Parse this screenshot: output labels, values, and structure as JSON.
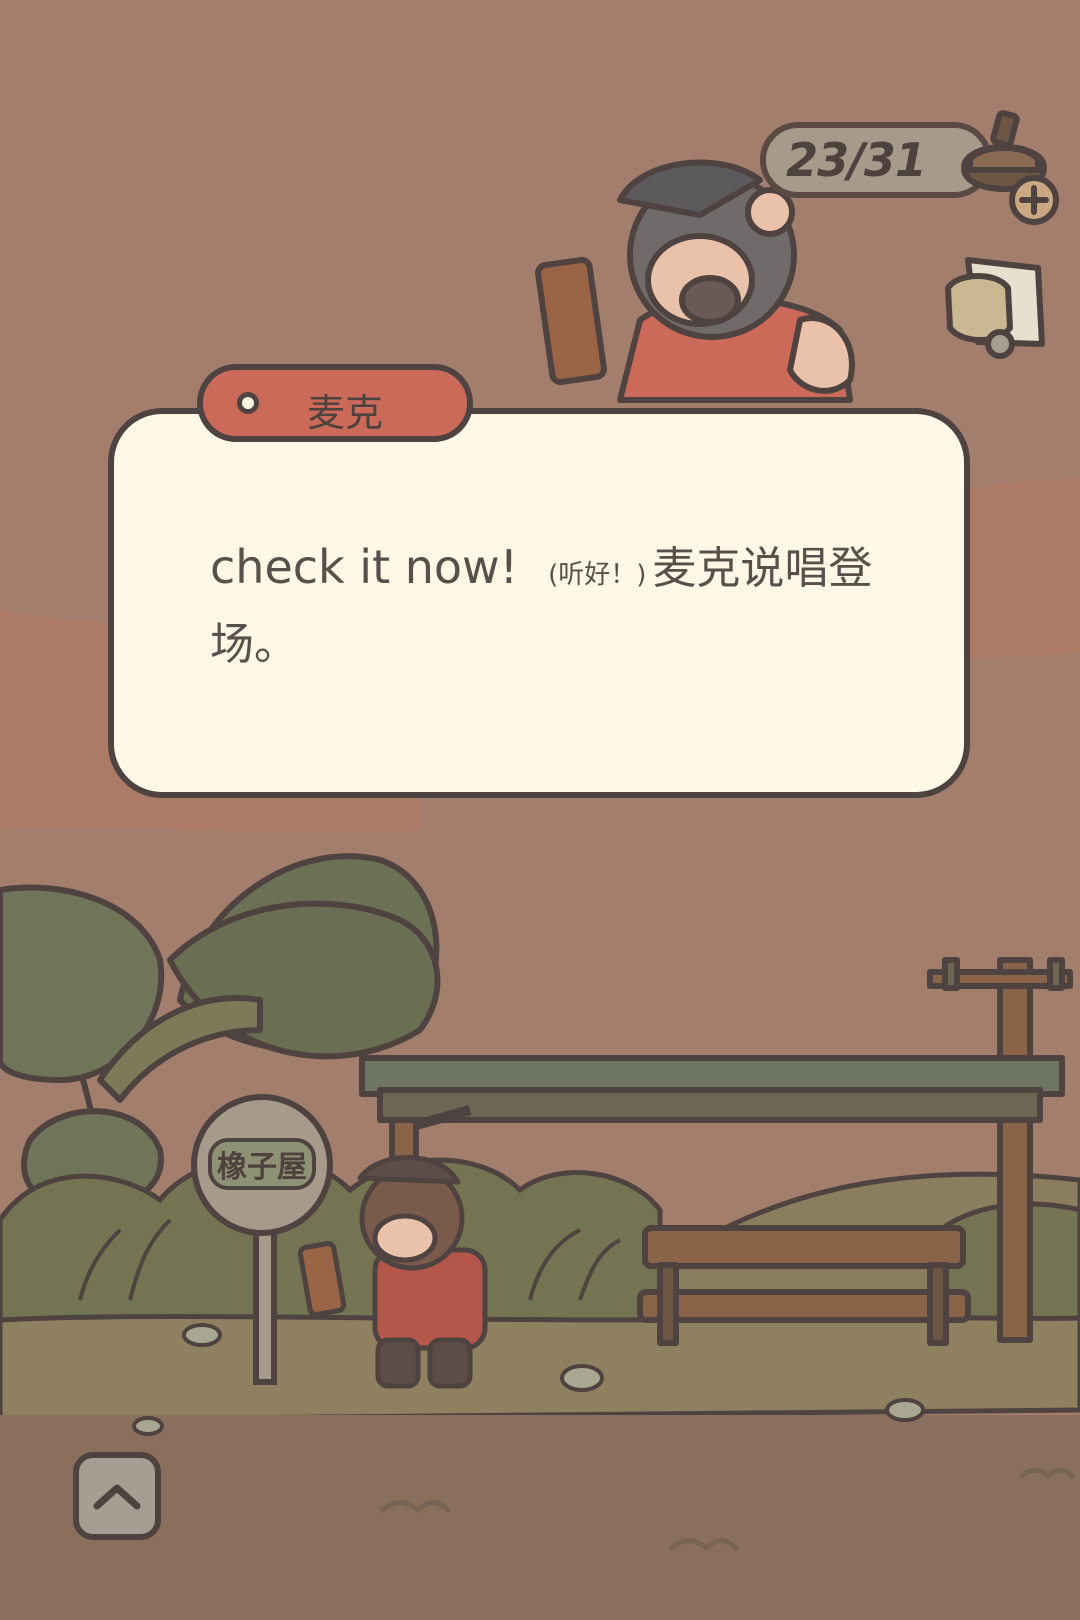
{
  "hud": {
    "energy_count": "23/31",
    "energy_icon": "acorn-energy-plus-icon",
    "side_icon": "fist-bump-icon"
  },
  "dialog": {
    "speaker_name": "麦克",
    "line_en": "check it now!",
    "line_note": "(听好！)",
    "line_cn": "麦克说唱登场。"
  },
  "scene": {
    "bus_stop_sign": "橡子屋"
  },
  "controls": {
    "collapse_icon": "chevron-up-icon"
  },
  "colors": {
    "background": "#a47e6c",
    "dialog_bg": "#fdf9e6",
    "name_tab": "#cc6a5a",
    "outline": "#4e4340"
  }
}
